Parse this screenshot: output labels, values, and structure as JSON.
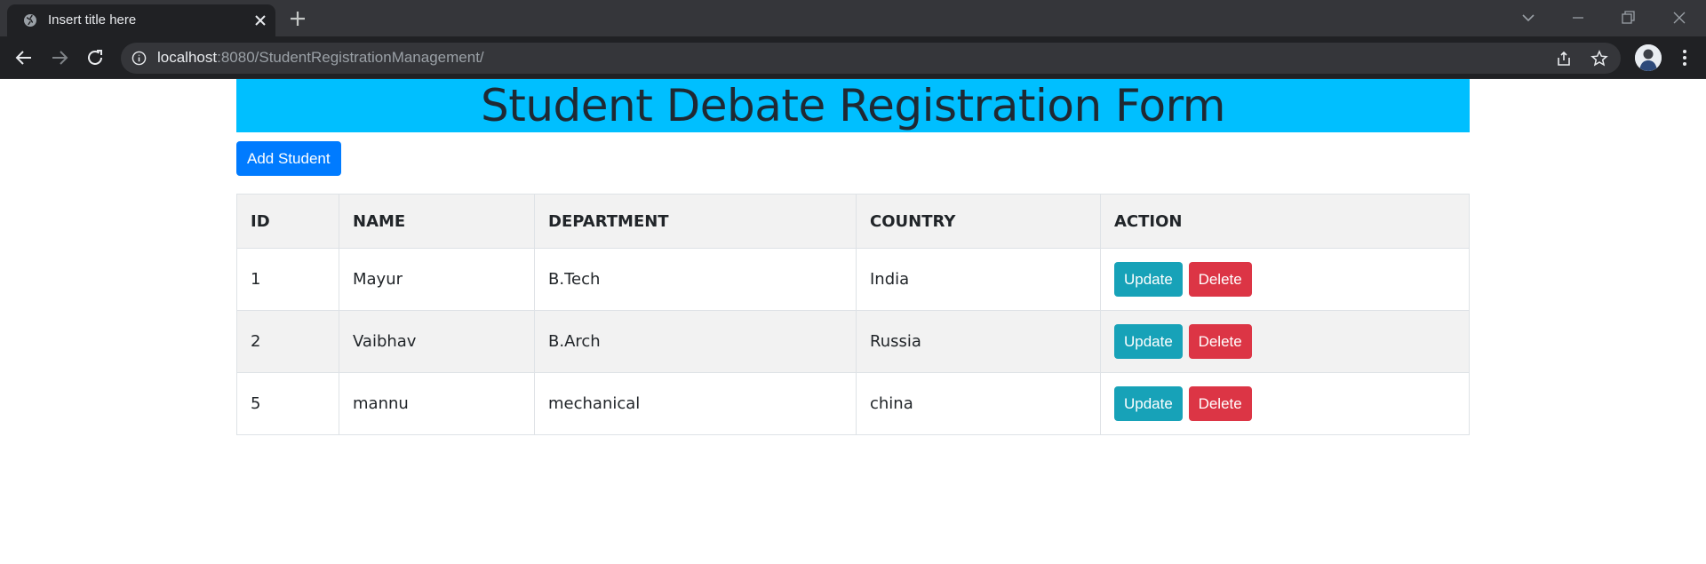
{
  "browser": {
    "tab_title": "Insert title here",
    "url_host": "localhost",
    "url_rest": ":8080/StudentRegistrationManagement/"
  },
  "page": {
    "heading": "Student Debate Registration Form",
    "add_button": "Add Student",
    "table": {
      "headers": [
        "ID",
        "NAME",
        "DEPARTMENT",
        "COUNTRY",
        "ACTION"
      ],
      "update_label": "Update",
      "delete_label": "Delete",
      "rows": [
        {
          "id": "1",
          "name": "Mayur",
          "department": "B.Tech",
          "country": "India"
        },
        {
          "id": "2",
          "name": "Vaibhav",
          "department": "B.Arch",
          "country": "Russia"
        },
        {
          "id": "5",
          "name": "mannu",
          "department": "mechanical",
          "country": "china"
        }
      ]
    }
  },
  "colors": {
    "header_bg": "#00bfff",
    "primary": "#007bff",
    "info": "#17a2b8",
    "danger": "#dc3545"
  }
}
